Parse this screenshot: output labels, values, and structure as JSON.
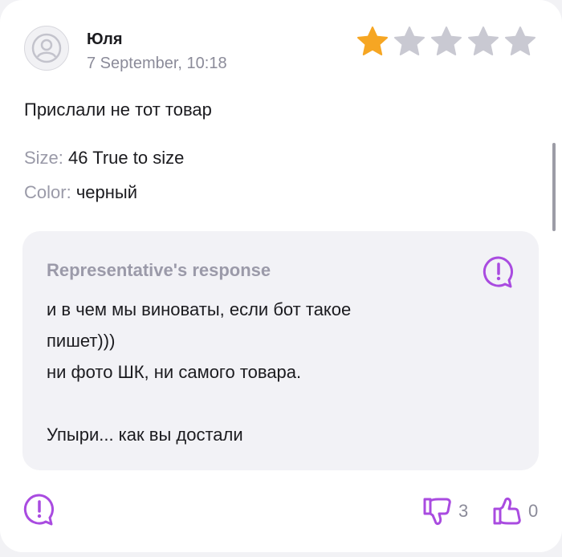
{
  "review": {
    "author": "Юля",
    "date": "7 September, 10:18",
    "rating": 1,
    "rating_max": 5,
    "text": "Прислали не тот товар",
    "size_label": "Size:",
    "size_value": "46 True to size",
    "color_label": "Color:",
    "color_value": "черный"
  },
  "response": {
    "title": "Representative's response",
    "lines": [
      "и в чем мы виноваты, если бот такое",
      "пишет)))",
      "ни фото ШК, ни самого товара.",
      "",
      "Упыри... как вы достали"
    ]
  },
  "actions": {
    "dislike_count": "3",
    "like_count": "0"
  },
  "colors": {
    "accent_purple": "#a94be0",
    "star_active": "#f6a623",
    "star_inactive": "#c9c9d2"
  },
  "icons": [
    "user-avatar-icon",
    "star-icon",
    "report-icon",
    "thumbs-down-icon",
    "thumbs-up-icon"
  ]
}
